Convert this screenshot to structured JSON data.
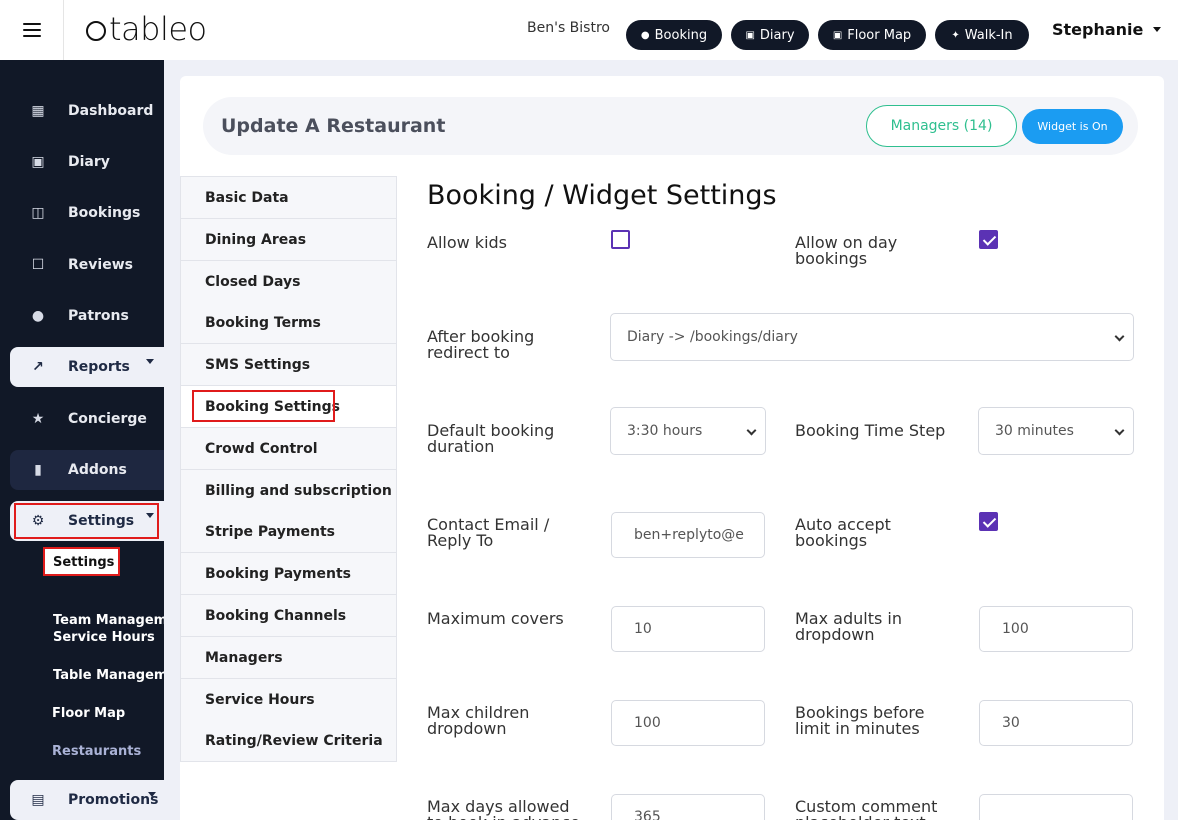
{
  "topbar": {
    "logo": "tableo",
    "restaurant": "Ben's Bistro",
    "buttons": [
      {
        "label": "Booking",
        "icon": "plus-circle-icon"
      },
      {
        "label": "Diary",
        "icon": "calendar-icon"
      },
      {
        "label": "Floor Map",
        "icon": "calendar-icon"
      },
      {
        "label": "Walk-In",
        "icon": "walking-icon"
      }
    ],
    "user": "Stephanie"
  },
  "sidebar": {
    "items": [
      {
        "label": "Dashboard",
        "icon": "dashboard-icon"
      },
      {
        "label": "Diary",
        "icon": "calendar-icon"
      },
      {
        "label": "Bookings",
        "icon": "bookings-icon"
      },
      {
        "label": "Reviews",
        "icon": "review-icon"
      },
      {
        "label": "Patrons",
        "icon": "person-icon"
      },
      {
        "label": "Reports",
        "icon": "chart-icon"
      },
      {
        "label": "Concierge",
        "icon": "star-icon"
      },
      {
        "label": "Addons",
        "icon": "addon-icon"
      },
      {
        "label": "Settings",
        "icon": "gear-icon"
      },
      {
        "label": "Promotions",
        "icon": "gift-icon"
      }
    ],
    "settings_sub": [
      "Settings",
      "Team Management",
      "Service Hours",
      "Table Management",
      "Floor Map",
      "Restaurants"
    ]
  },
  "header": {
    "title": "Update A Restaurant",
    "managers_label": "Managers (14)",
    "widget_label": "Widget is On"
  },
  "menu": {
    "items": [
      "Basic Data",
      "Dining Areas",
      "Closed Days",
      "Booking Terms",
      "SMS Settings",
      "Booking Settings",
      "Crowd Control",
      "Billing and subscription",
      "Stripe Payments",
      "Booking Payments",
      "Booking Channels",
      "Managers",
      "Service Hours",
      "Rating/Review Criteria"
    ],
    "active": "Booking Settings"
  },
  "form": {
    "title": "Booking / Widget Settings",
    "allow_kids": {
      "label": "Allow kids",
      "checked": false
    },
    "allow_on_day": {
      "label": "Allow on day bookings",
      "checked": true
    },
    "redirect": {
      "label": "After booking redirect to",
      "value": "Diary -> /bookings/diary"
    },
    "default_duration": {
      "label": "Default booking duration",
      "value": "3:30 hours"
    },
    "time_step": {
      "label": "Booking Time Step",
      "value": "30 minutes"
    },
    "contact_email": {
      "label": "Contact Email / Reply To",
      "value": "ben+replyto@e"
    },
    "auto_accept": {
      "label": "Auto accept bookings",
      "checked": true
    },
    "max_covers": {
      "label": "Maximum covers",
      "value": "10"
    },
    "max_adults": {
      "label": "Max adults in dropdown",
      "value": "100"
    },
    "max_children": {
      "label": "Max children dropdown",
      "value": "100"
    },
    "bookings_before": {
      "label": "Bookings before limit in minutes",
      "value": "30"
    },
    "max_days": {
      "label": "Max days allowed to book in advance",
      "value": "365"
    },
    "custom_comment": {
      "label": "Custom comment placeholder text",
      "value": ""
    }
  },
  "colors": {
    "sidebar": "#111827",
    "accent_green": "#2fbf8f",
    "accent_blue": "#1b9cf2",
    "checkbox": "#5b32b4",
    "highlight": "#e01b1b"
  }
}
